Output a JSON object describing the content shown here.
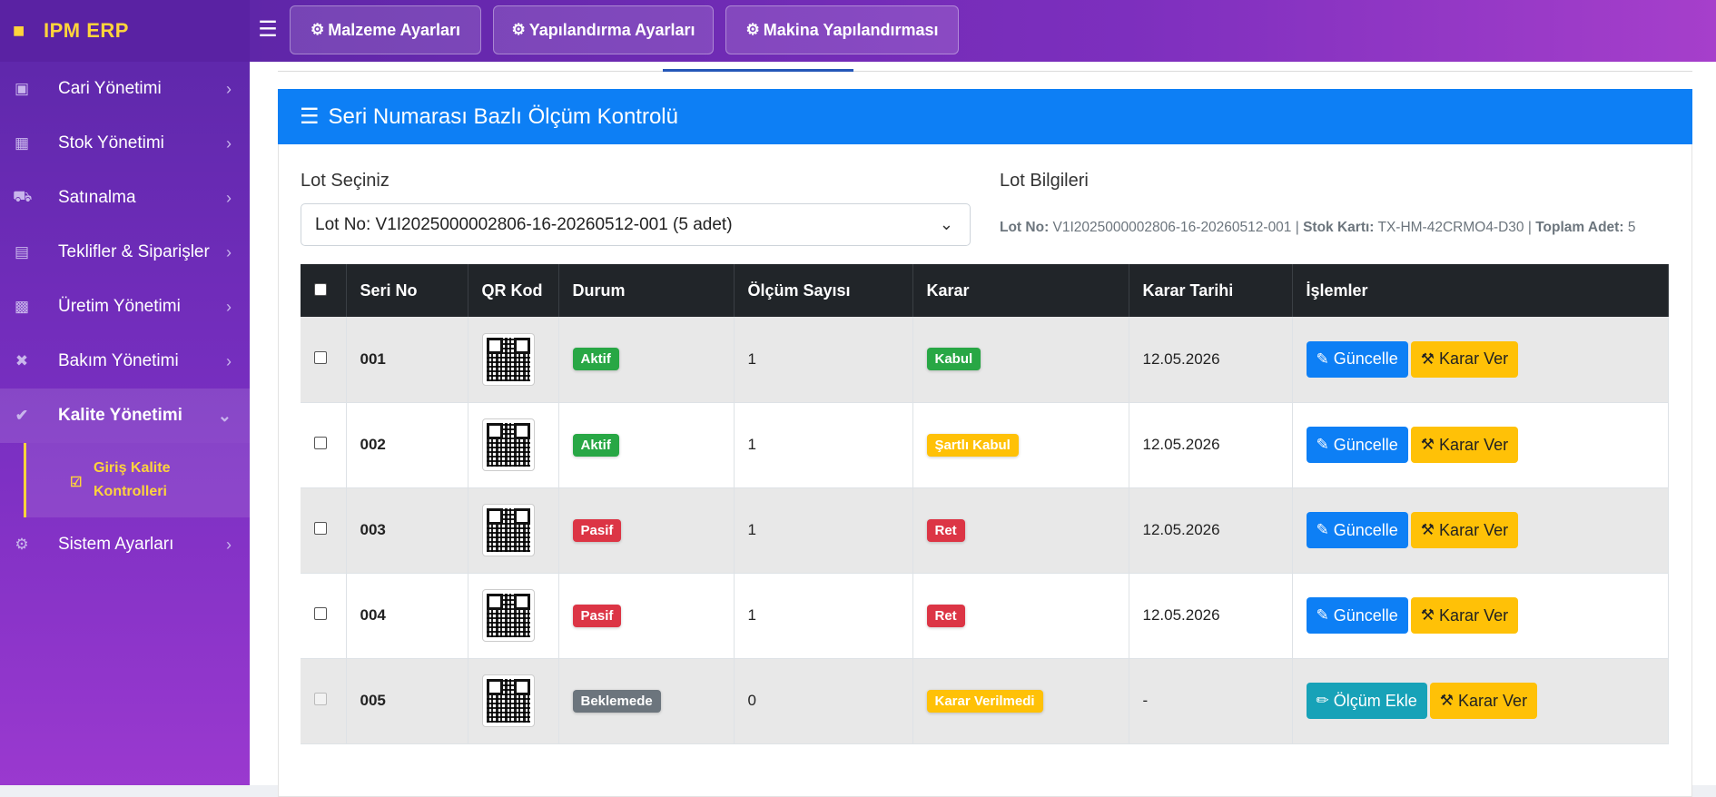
{
  "brand": {
    "name": "IPM ERP",
    "icon": "factory-icon"
  },
  "topbar": {
    "buttons": [
      {
        "label": "Malzeme Ayarları",
        "icon": "cogs-icon"
      },
      {
        "label": "Yapılandırma Ayarları",
        "icon": "gear-icon"
      },
      {
        "label": "Makina Yapılandırması",
        "icon": "gears-icon"
      }
    ]
  },
  "sidebar": {
    "items": [
      {
        "label": "Cari Yönetimi",
        "icon": "building-icon"
      },
      {
        "label": "Stok Yönetimi",
        "icon": "boxes-icon"
      },
      {
        "label": "Satınalma",
        "icon": "cart-icon"
      },
      {
        "label": "Teklifler & Siparişler",
        "icon": "document-icon"
      },
      {
        "label": "Üretim Yönetimi",
        "icon": "chart-icon"
      },
      {
        "label": "Bakım Yönetimi",
        "icon": "tools-icon"
      },
      {
        "label": "Kalite Yönetimi",
        "icon": "check-circle-icon"
      },
      {
        "label": "Sistem Ayarları",
        "icon": "gear-icon"
      }
    ],
    "subitem": {
      "label": "Giriş Kalite Kontrolleri",
      "icon": "clipboard-check-icon"
    }
  },
  "card": {
    "title": "Seri Numarası Bazlı Ölçüm Kontrolü",
    "lot_select_label": "Lot Seçiniz",
    "lot_select_value": "Lot No: V1I2025000002806-16-20260512-001 (5 adet)",
    "lot_info_label": "Lot Bilgileri",
    "lot_info": {
      "lot_no_label": "Lot No:",
      "lot_no": "V1I2025000002806-16-20260512-001",
      "stock_label": "Stok Kartı:",
      "stock": "TX-HM-42CRMO4-D30",
      "total_label": "Toplam Adet:",
      "total": "5"
    }
  },
  "table": {
    "headers": [
      "Seri No",
      "QR Kod",
      "Durum",
      "Ölçüm Sayısı",
      "Karar",
      "Karar Tarihi",
      "İşlemler"
    ],
    "rows": [
      {
        "seri": "001",
        "durum": "Aktif",
        "olcum": "1",
        "karar": "Kabul",
        "tarih": "12.05.2026",
        "btn1": "Güncelle",
        "btn2": "Karar Ver"
      },
      {
        "seri": "002",
        "durum": "Aktif",
        "olcum": "1",
        "karar": "Şartlı Kabul",
        "tarih": "12.05.2026",
        "btn1": "Güncelle",
        "btn2": "Karar Ver"
      },
      {
        "seri": "003",
        "durum": "Pasif",
        "olcum": "1",
        "karar": "Ret",
        "tarih": "12.05.2026",
        "btn1": "Güncelle",
        "btn2": "Karar Ver"
      },
      {
        "seri": "004",
        "durum": "Pasif",
        "olcum": "1",
        "karar": "Ret",
        "tarih": "12.05.2026",
        "btn1": "Güncelle",
        "btn2": "Karar Ver"
      },
      {
        "seri": "005",
        "durum": "Beklemede",
        "olcum": "0",
        "karar": "Karar Verilmedi",
        "tarih": "-",
        "btn1": "Ölçüm Ekle",
        "btn2": "Karar Ver"
      }
    ]
  },
  "colors": {
    "primary": "#0d7ff5",
    "success": "#28a745",
    "danger": "#dc3545",
    "warning": "#ffc107",
    "secondary": "#6c757d",
    "info": "#17a2b8",
    "brand_yellow": "#ffd43b"
  }
}
